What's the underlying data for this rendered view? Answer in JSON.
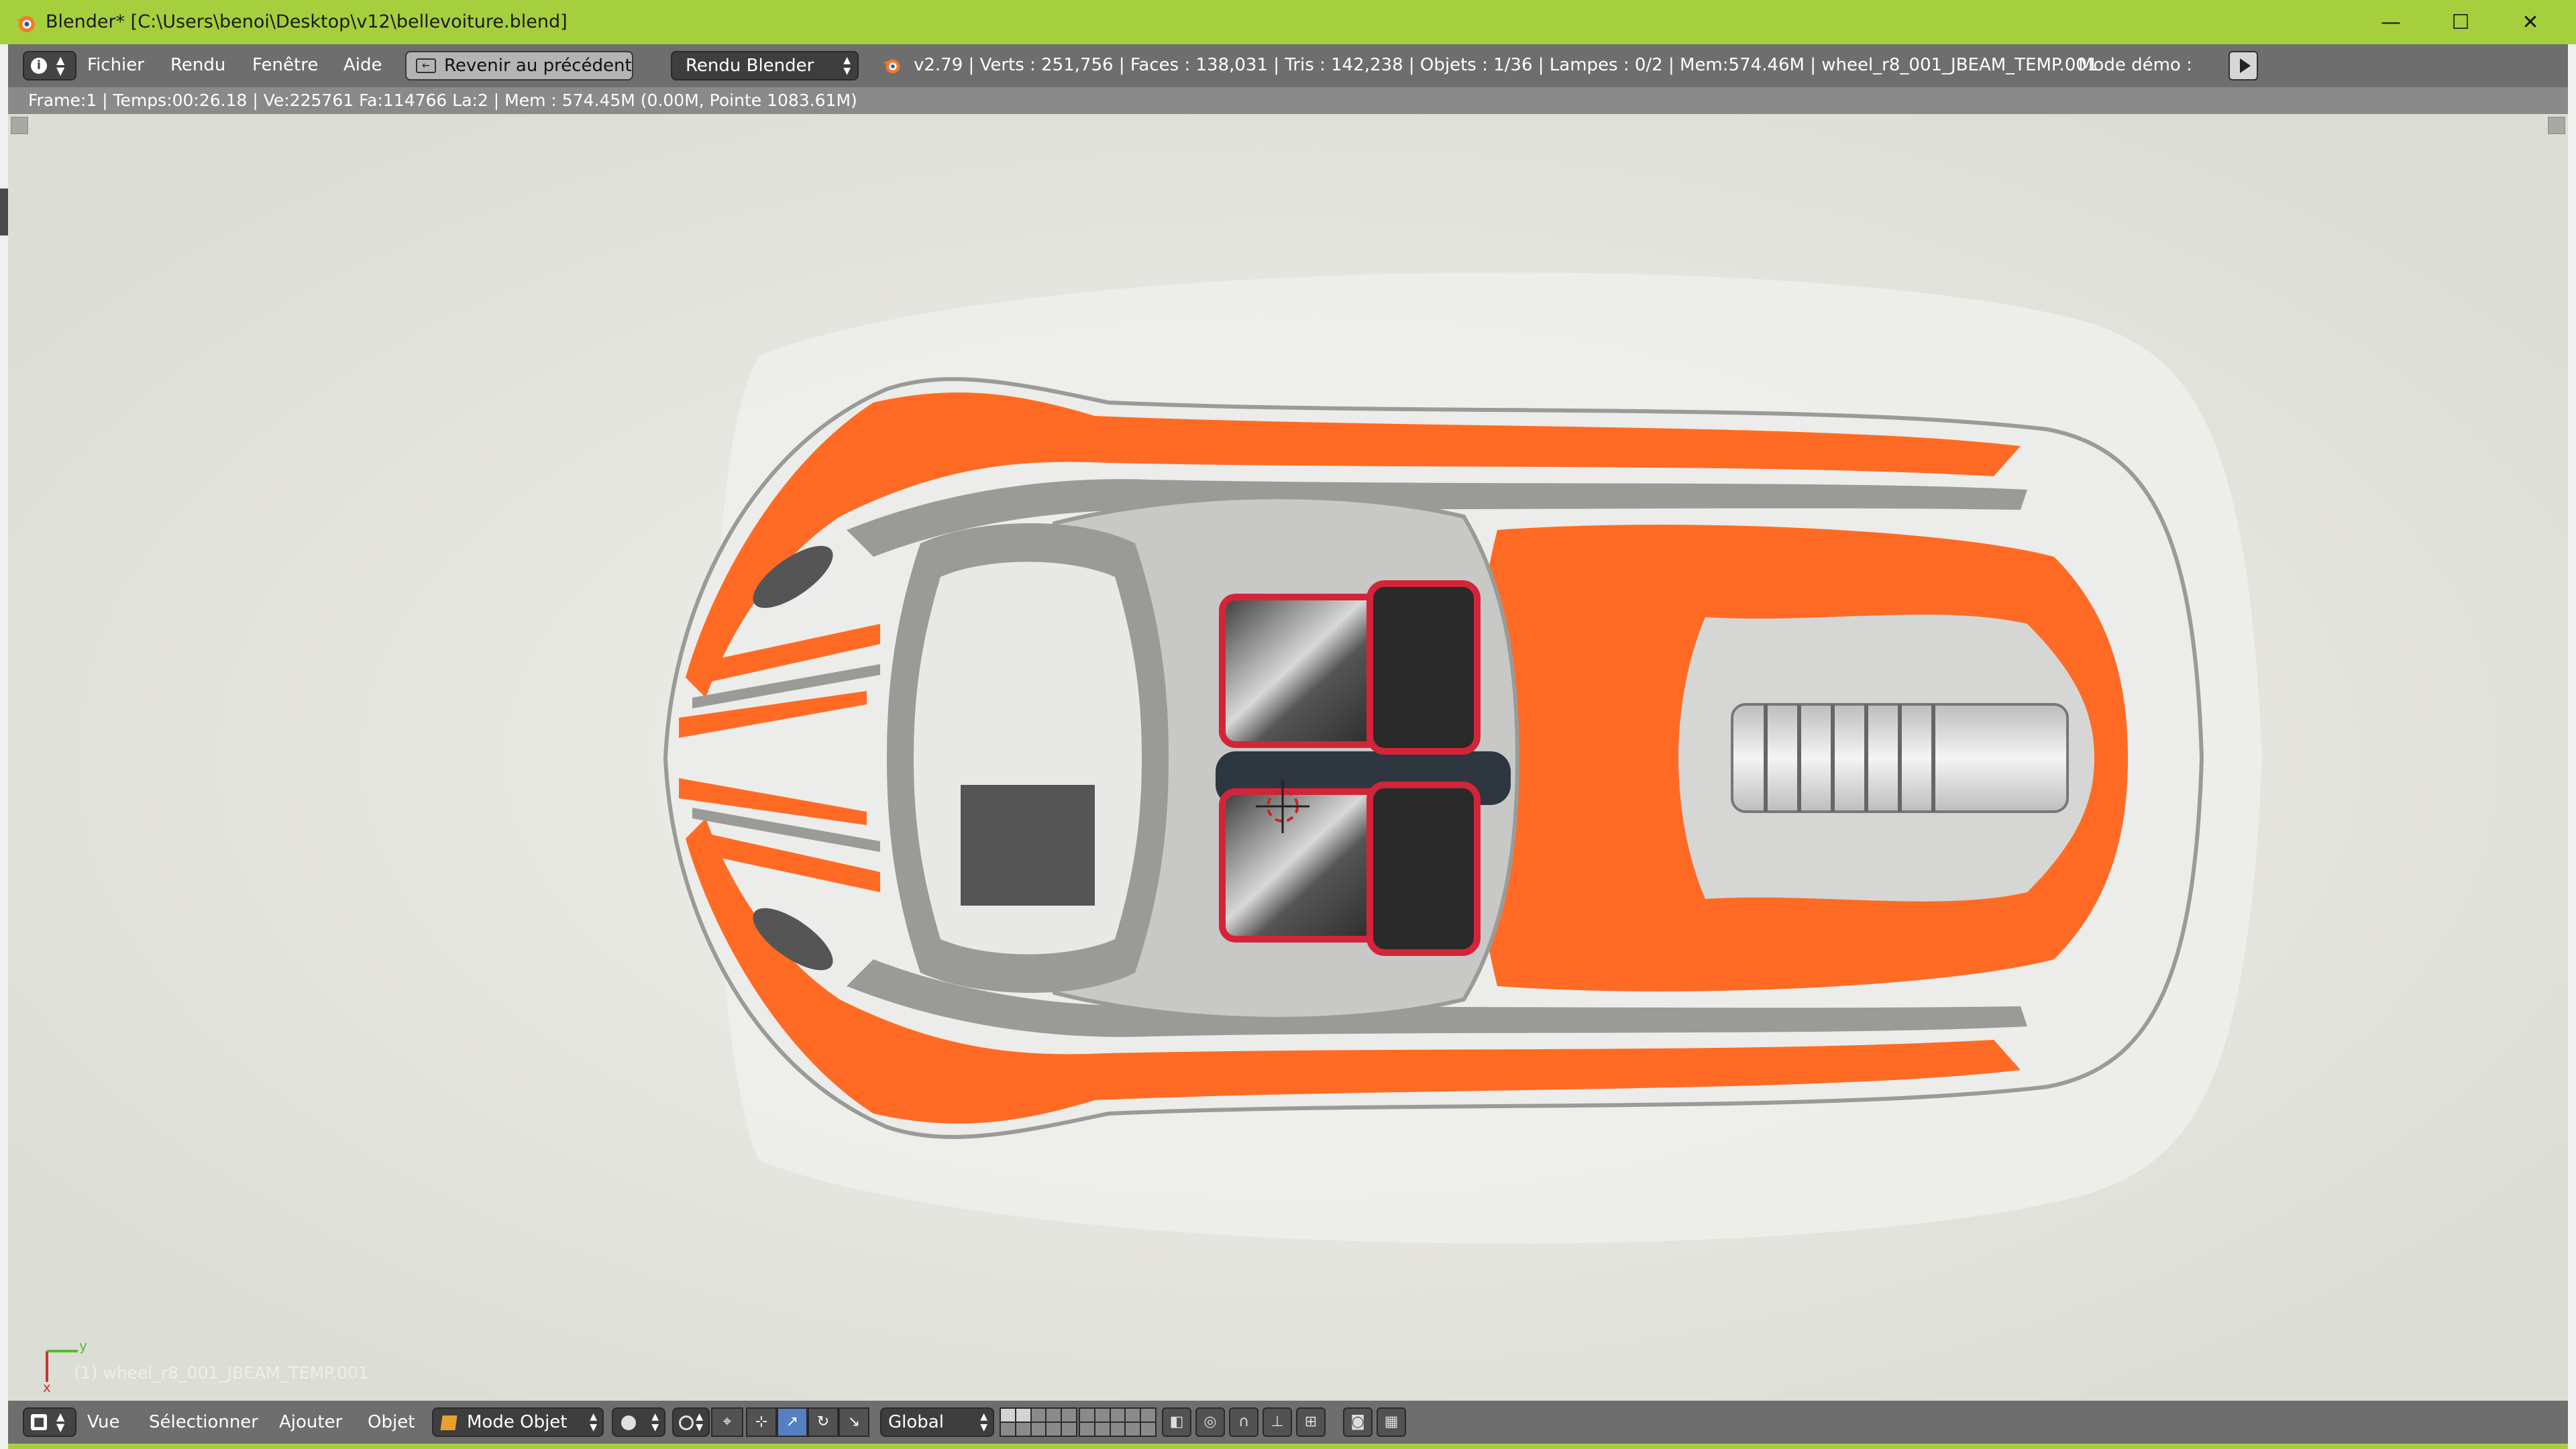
{
  "window": {
    "title": "Blender* [C:\\Users\\benoi\\Desktop\\v12\\bellevoiture.blend]",
    "controls": {
      "minimize": "—",
      "maximize": "☐",
      "close": "✕"
    }
  },
  "info_header": {
    "editor_icon": "info-icon",
    "menus": [
      "Fichier",
      "Rendu",
      "Fenêtre",
      "Aide"
    ],
    "back_button": "Revenir au précédent",
    "render_engine": "Rendu Blender",
    "stats": "v2.79 | Verts : 251,756 | Faces : 138,031 | Tris : 142,238 | Objets : 1/36 | Lampes : 0/2 | Mem:574.46M | wheel_r8_001_JBEAM_TEMP.001",
    "demo_mode": "Mode démo :"
  },
  "render_stats": "Frame:1 | Temps:00:26.18 | Ve:225761 Fa:114766 La:2 | Mem : 574.45M (0.00M, Pointe 1083.61M)",
  "viewport": {
    "object_label": "(1) wheel_r8_001_JBEAM_TEMP.001",
    "axis_labels": {
      "x": "x",
      "y": "y"
    },
    "colors": {
      "background": "#dedfd6",
      "body_orange": "#ff6b24",
      "body_white": "#ececea",
      "body_gray": "#9a9a98"
    }
  },
  "view3d_header": {
    "editor_icon": "view3d-icon",
    "menus": [
      "Vue",
      "Sélectionner",
      "Ajouter",
      "Objet"
    ],
    "mode": "Mode Objet",
    "orientation": "Global"
  }
}
